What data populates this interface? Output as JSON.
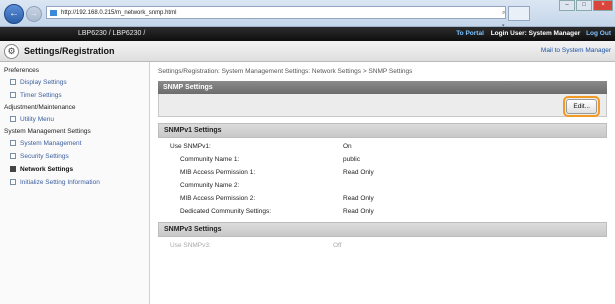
{
  "browser": {
    "url": "http://192.168.0.215/m_network_snmp.html",
    "address_tools": "⌕ ▾ ☐ ×",
    "back": "←",
    "forward": "→",
    "window_min": "–",
    "window_max": "□",
    "window_close": "×"
  },
  "header": {
    "model": "LBP6230 / LBP6230 /",
    "portal": "To Portal",
    "login": "Login User: System Manager",
    "logout": "Log Out"
  },
  "title_bar": {
    "title": "Settings/Registration",
    "mail": "Mail to System Manager",
    "icon": "⚙"
  },
  "sidebar": {
    "sections": [
      {
        "label": "Preferences",
        "items": [
          "Display Settings",
          "Timer Settings"
        ]
      },
      {
        "label": "Adjustment/Maintenance",
        "items": [
          "Utility Menu"
        ]
      },
      {
        "label": "System Management Settings",
        "items": [
          "System Management",
          "Security Settings",
          "Network Settings",
          "Initialize Setting Information"
        ]
      }
    ]
  },
  "breadcrumb": "Settings/Registration: System Management Settings: Network Settings > SNMP Settings",
  "snmp": {
    "title": "SNMP Settings",
    "edit": "Edit..."
  },
  "v1": {
    "title": "SNMPv1 Settings",
    "rows": [
      {
        "label": "Use SNMPv1:",
        "value": "On"
      },
      {
        "label": "Community Name 1:",
        "value": "public"
      },
      {
        "label": "MIB Access Permission 1:",
        "value": "Read Only"
      },
      {
        "label": "Community Name 2:",
        "value": ""
      },
      {
        "label": "MIB Access Permission 2:",
        "value": "Read Only"
      },
      {
        "label": "Dedicated Community Settings:",
        "value": "Read Only"
      }
    ]
  },
  "v3": {
    "title": "SNMPv3 Settings",
    "rows": [
      {
        "label": "Use SNMPv3:",
        "value": "Off"
      }
    ]
  }
}
